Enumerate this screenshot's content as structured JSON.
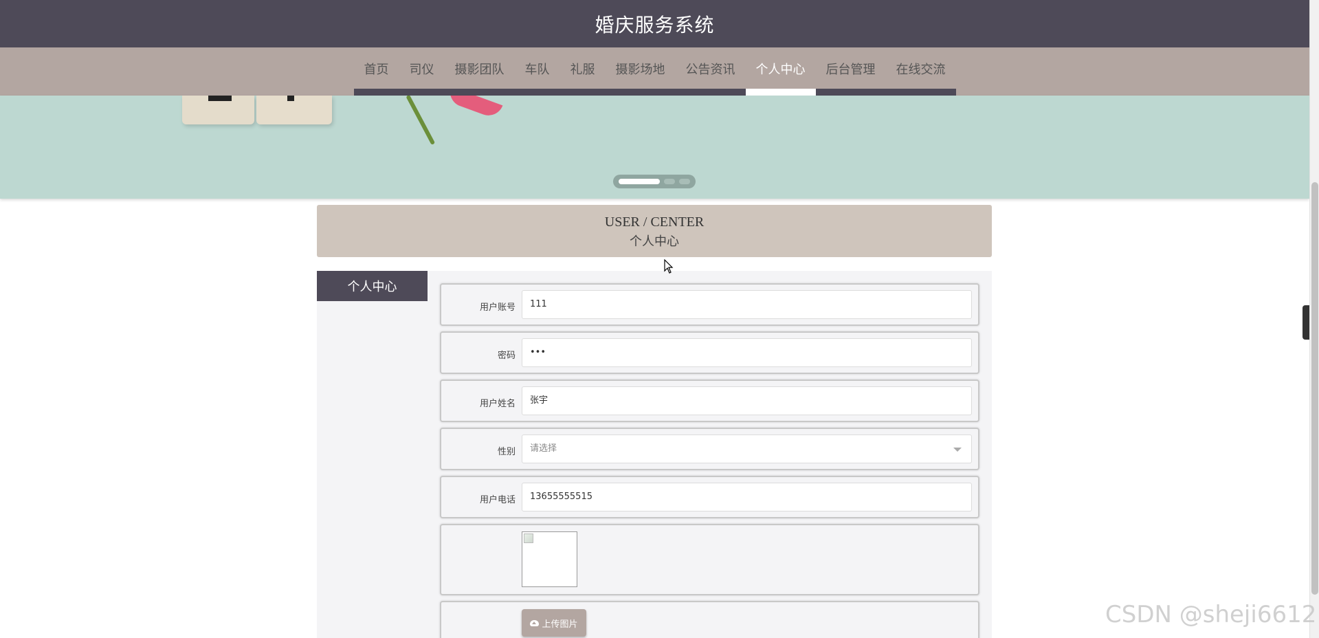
{
  "app": {
    "title": "婚庆服务系统"
  },
  "nav": {
    "items": [
      {
        "label": "首页"
      },
      {
        "label": "司仪"
      },
      {
        "label": "摄影团队"
      },
      {
        "label": "车队"
      },
      {
        "label": "礼服"
      },
      {
        "label": "摄影场地"
      },
      {
        "label": "公告资讯"
      },
      {
        "label": "个人中心"
      },
      {
        "label": "后台管理"
      },
      {
        "label": "在线交流"
      }
    ],
    "active_index": 7
  },
  "banner": {
    "slides": 3,
    "active_slide": 1
  },
  "section": {
    "title_en": "USER / CENTER",
    "title_cn": "个人中心"
  },
  "sidebar": {
    "tab_label": "个人中心"
  },
  "form": {
    "account": {
      "label": "用户账号",
      "value": "111"
    },
    "password": {
      "label": "密码",
      "value": "•••"
    },
    "name": {
      "label": "用户姓名",
      "value": "张宇"
    },
    "gender": {
      "label": "性别",
      "placeholder": "请选择"
    },
    "phone": {
      "label": "用户电话",
      "value": "13655555515"
    },
    "upload_button": "上传图片"
  },
  "watermark": "CSDN @sheji6612",
  "colors": {
    "header": "#4e4a58",
    "nav": "#b3a6a1",
    "banner": "#bdd8d1",
    "title_box": "#cfc5bc"
  },
  "icons": {
    "upload": "cloud-upload-icon",
    "select": "chevron-down-icon",
    "handle": "chevron-left-icon"
  }
}
